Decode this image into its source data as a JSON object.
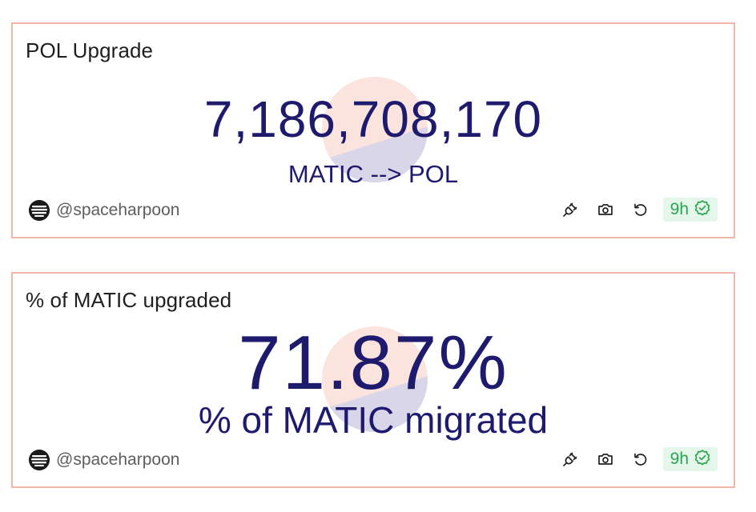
{
  "colors": {
    "card_border": "#f2b6a8",
    "value_text": "#1e1a6e",
    "title_text": "#1f1f1f",
    "author_text": "#5e5e5e",
    "badge_bg": "#e4f7ea",
    "badge_text": "#2aa653",
    "watermark_top": "#f6c2b6",
    "watermark_bottom": "#cfd2ee"
  },
  "cards": [
    {
      "title": "POL Upgrade",
      "value": "7,186,708,170",
      "subtitle": "MATIC --> POL",
      "author": "@spaceharpoon",
      "freshness": "9h",
      "icons": [
        "plug-icon",
        "camera-icon",
        "refresh-icon",
        "check-badge-icon"
      ]
    },
    {
      "title": "% of MATIC upgraded",
      "value": "71.87%",
      "subtitle": "% of MATIC migrated",
      "author": "@spaceharpoon",
      "freshness": "9h",
      "icons": [
        "plug-icon",
        "camera-icon",
        "refresh-icon",
        "check-badge-icon"
      ]
    }
  ]
}
